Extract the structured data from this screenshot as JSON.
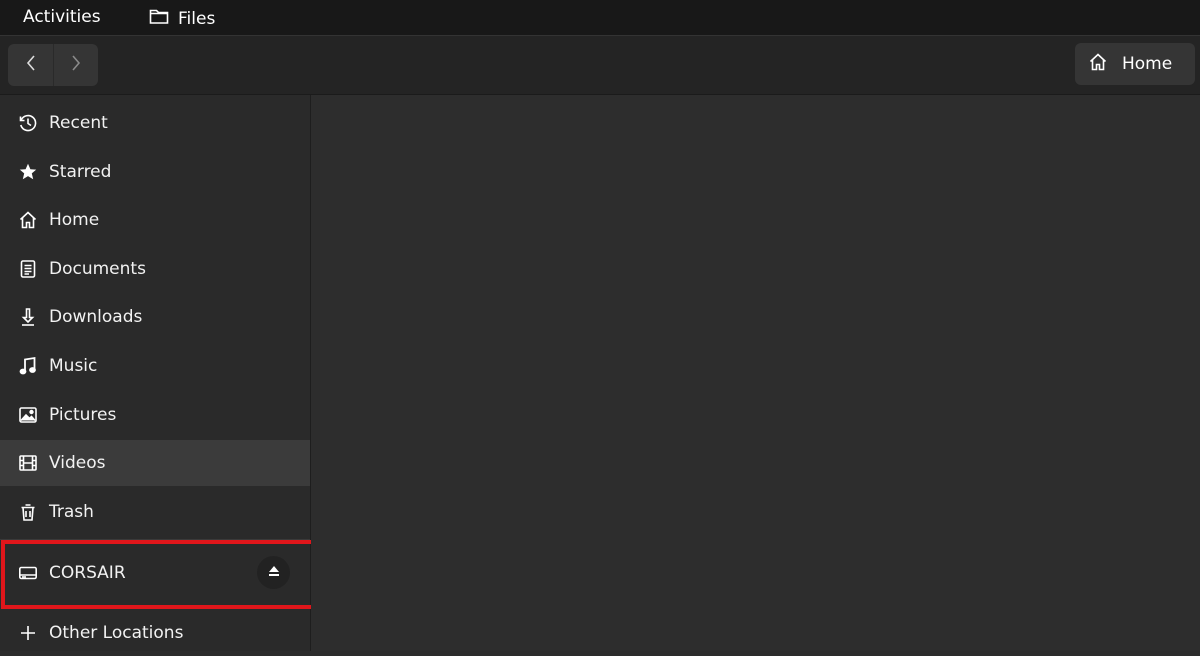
{
  "topbar": {
    "activities": "Activities",
    "app_name": "Files"
  },
  "header": {
    "back_icon": "chevron-left-icon",
    "forward_icon": "chevron-right-icon",
    "path_label": "Home",
    "path_icon": "home-icon"
  },
  "sidebar": {
    "items": [
      {
        "label": "Recent",
        "icon": "clock-icon"
      },
      {
        "label": "Starred",
        "icon": "star-icon"
      },
      {
        "label": "Home",
        "icon": "home-icon"
      },
      {
        "label": "Documents",
        "icon": "document-icon"
      },
      {
        "label": "Downloads",
        "icon": "download-icon"
      },
      {
        "label": "Music",
        "icon": "music-icon"
      },
      {
        "label": "Pictures",
        "icon": "picture-icon"
      },
      {
        "label": "Videos",
        "icon": "film-icon",
        "selected": true
      },
      {
        "label": "Trash",
        "icon": "trash-icon"
      }
    ],
    "device": {
      "label": "CORSAIR",
      "icon": "drive-icon",
      "action_icon": "eject-icon"
    },
    "other": {
      "label": "Other Locations",
      "icon": "plus-icon"
    }
  },
  "colors": {
    "highlight": "#e0161b",
    "selected_bg": "#3b3b3b",
    "topbar_bg": "#181818"
  }
}
